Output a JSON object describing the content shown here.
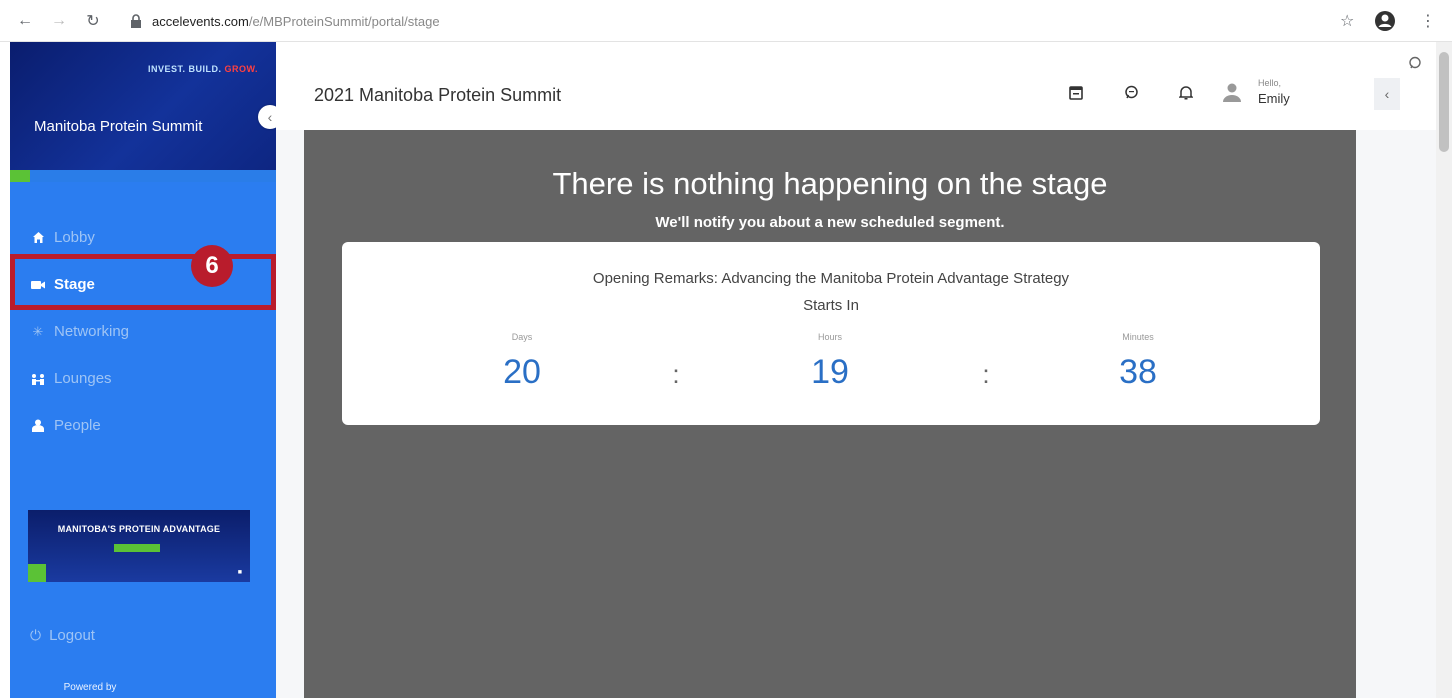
{
  "browser": {
    "url_host": "accelevents.com",
    "url_path": "/e/MBProteinSummit/portal/stage"
  },
  "sidebar": {
    "banner_tagline_1": "INVEST. BUILD. ",
    "banner_tagline_2": "GROW.",
    "banner_title": "Manitoba Protein Summit",
    "items": [
      {
        "label": "Lobby",
        "icon": "home-icon"
      },
      {
        "label": "Stage",
        "icon": "video-icon"
      },
      {
        "label": "Networking",
        "icon": "networking-icon"
      },
      {
        "label": "Lounges",
        "icon": "lounges-icon"
      },
      {
        "label": "People",
        "icon": "people-icon"
      }
    ],
    "active_item": "Stage",
    "promo_text": "MANITOBA'S PROTEIN ADVANTAGE",
    "logout_label": "Logout",
    "powered_by": "Powered by"
  },
  "annotation": {
    "step_number": "6"
  },
  "header": {
    "event_title": "2021 Manitoba Protein Summit",
    "greeting": "Hello,",
    "user_name": "Emily"
  },
  "stage": {
    "title": "There is nothing happening on the stage",
    "subtitle": "We'll notify you about a new scheduled segment.",
    "session_name": "Opening Remarks: Advancing the Manitoba Protein Advantage Strategy",
    "starts_in_label": "Starts In",
    "countdown": {
      "days_label": "Days",
      "days": "20",
      "hours_label": "Hours",
      "hours": "19",
      "minutes_label": "Minutes",
      "minutes": "38",
      "separator": ":"
    }
  },
  "colors": {
    "sidebar_bg": "#2b7df0",
    "highlight": "#b91c2c",
    "countdown_number": "#2a6fc5",
    "stage_bg": "#646464"
  }
}
